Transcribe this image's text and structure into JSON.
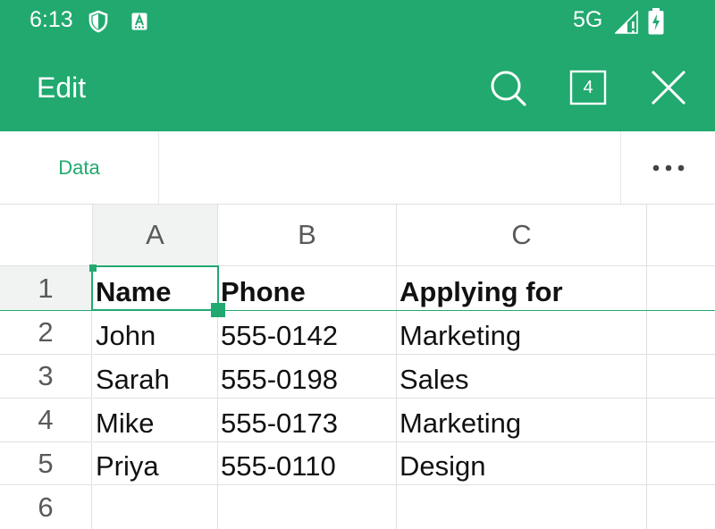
{
  "status_bar": {
    "time": "6:13",
    "network": "5G",
    "icons": [
      "shield-icon",
      "accessibility-a-icon",
      "signal-icon",
      "battery-charging-icon"
    ]
  },
  "toolbar": {
    "title": "Edit",
    "sheet_count": "4",
    "icons": [
      "search-icon",
      "sheets-icon",
      "close-icon"
    ]
  },
  "tabs": {
    "data_label": "Data",
    "more_icon": "more-horizontal-icon"
  },
  "sheet": {
    "columns": [
      "A",
      "B",
      "C"
    ],
    "rows": [
      {
        "num": "1",
        "cells": [
          "Name",
          "Phone",
          "Applying for"
        ]
      },
      {
        "num": "2",
        "cells": [
          "John",
          "555-0142",
          "Marketing"
        ]
      },
      {
        "num": "3",
        "cells": [
          "Sarah",
          "555-0198",
          "Sales"
        ]
      },
      {
        "num": "4",
        "cells": [
          "Mike",
          "555-0173",
          "Marketing"
        ]
      },
      {
        "num": "5",
        "cells": [
          "Priya",
          "555-0110",
          "Design"
        ]
      },
      {
        "num": "6",
        "cells": [
          "",
          "",
          ""
        ]
      }
    ],
    "selected_cell": "A1"
  },
  "colors": {
    "accent": "#21a96f",
    "grid_line": "#e0e0e0",
    "header_text": "#5a5a5a"
  }
}
